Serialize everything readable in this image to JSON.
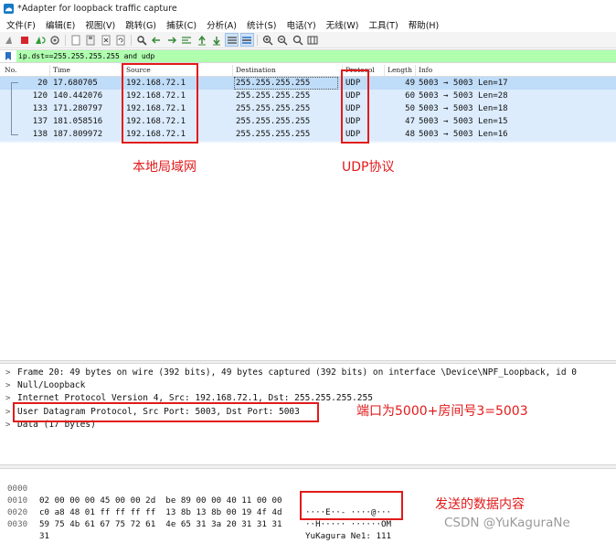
{
  "window": {
    "title": "*Adapter for loopback traffic capture"
  },
  "menu": [
    "文件(F)",
    "编辑(E)",
    "视图(V)",
    "跳转(G)",
    "捕获(C)",
    "分析(A)",
    "统计(S)",
    "电话(Y)",
    "无线(W)",
    "工具(T)",
    "帮助(H)"
  ],
  "toolbar": {
    "icons": [
      "shark-fin-start-icon",
      "stop-icon",
      "restart-capture-icon",
      "capture-options-icon",
      "open-file-icon",
      "save-file-icon",
      "close-file-icon",
      "reload-icon",
      "find-icon",
      "back-icon",
      "forward-icon",
      "goto-packet-icon",
      "first-packet-icon",
      "last-packet-icon",
      "autoscroll-icon",
      "colorize-icon",
      "zoom-in-icon",
      "zoom-out-icon",
      "zoom-normal-icon",
      "resize-columns-icon"
    ]
  },
  "filter": {
    "value": "ip.dst==255.255.255.255 and udp"
  },
  "columns": {
    "no": "No.",
    "time": "Time",
    "source": "Source",
    "destination": "Destination",
    "protocol": "Protocol",
    "length": "Length",
    "info": "Info"
  },
  "packets": [
    {
      "no": "20",
      "time": "17.680705",
      "source": "192.168.72.1",
      "destination": "255.255.255.255",
      "protocol": "UDP",
      "length": "49",
      "info": "5003 → 5003 Len=17"
    },
    {
      "no": "120",
      "time": "140.442076",
      "source": "192.168.72.1",
      "destination": "255.255.255.255",
      "protocol": "UDP",
      "length": "60",
      "info": "5003 → 5003 Len=28"
    },
    {
      "no": "133",
      "time": "171.280797",
      "source": "192.168.72.1",
      "destination": "255.255.255.255",
      "protocol": "UDP",
      "length": "50",
      "info": "5003 → 5003 Len=18"
    },
    {
      "no": "137",
      "time": "181.058516",
      "source": "192.168.72.1",
      "destination": "255.255.255.255",
      "protocol": "UDP",
      "length": "47",
      "info": "5003 → 5003 Len=15"
    },
    {
      "no": "138",
      "time": "187.809972",
      "source": "192.168.72.1",
      "destination": "255.255.255.255",
      "protocol": "UDP",
      "length": "48",
      "info": "5003 → 5003 Len=16"
    }
  ],
  "annotations": {
    "lan": "本地局域网",
    "udp": "UDP协议",
    "port": "端口为5000+房间号3=5003",
    "data": "发送的数据内容"
  },
  "details": [
    "Frame 20: 49 bytes on wire (392 bits), 49 bytes captured (392 bits) on interface \\Device\\NPF_Loopback, id 0",
    "Null/Loopback",
    "Internet Protocol Version 4, Src: 192.168.72.1, Dst: 255.255.255.255",
    "User Datagram Protocol, Src Port: 5003, Dst Port: 5003",
    "Data (17 bytes)"
  ],
  "hex": [
    {
      "offset": "0000",
      "bytes": "02 00 00 00 45 00 00 2d  be 89 00 00 40 11 00 00",
      "ascii": "····E··- ····@···"
    },
    {
      "offset": "0010",
      "bytes": "c0 a8 48 01 ff ff ff ff  13 8b 13 8b 00 19 4f 4d",
      "ascii": "··H····· ······OM"
    },
    {
      "offset": "0020",
      "bytes": "59 75 4b 61 67 75 72 61  4e 65 31 3a 20 31 31 31",
      "ascii": "YuKagura Ne1: 111"
    },
    {
      "offset": "0030",
      "bytes": "31",
      "ascii": "1"
    }
  ],
  "watermark": "CSDN @YuKaguraNe",
  "colors": {
    "selected_row": "#bfdcf8",
    "row": "#dcecfd",
    "filter_ok": "#afffaf",
    "annotation": "#e21a1a"
  }
}
